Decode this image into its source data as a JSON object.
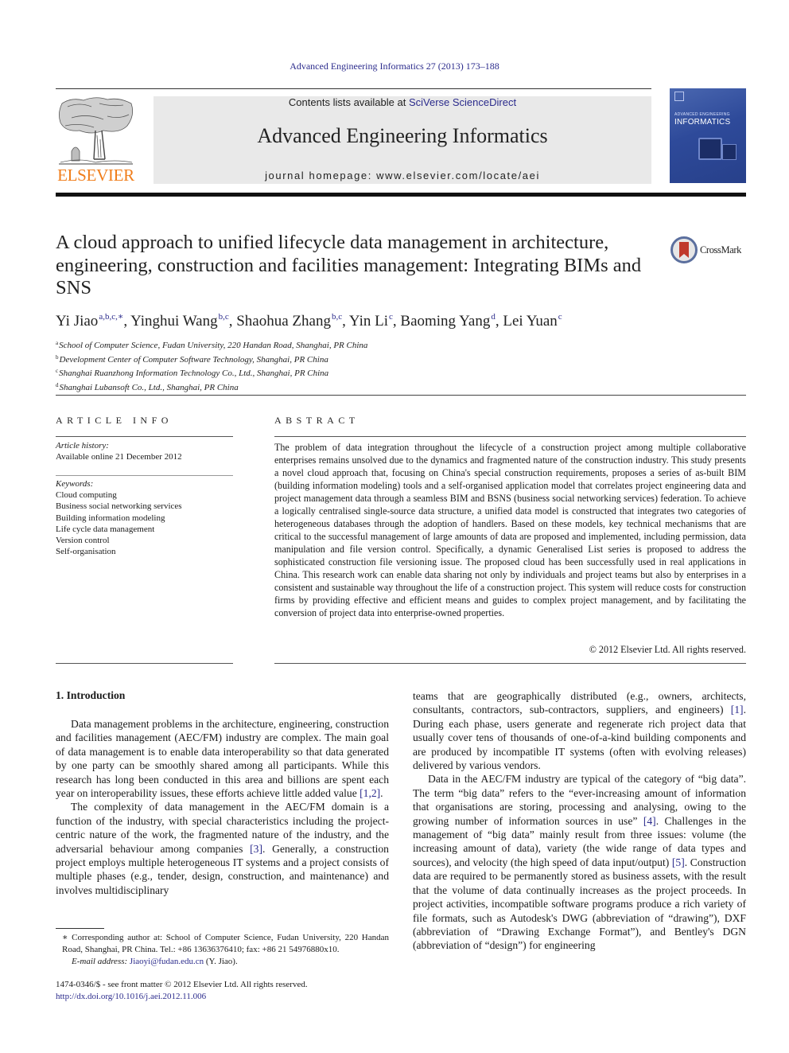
{
  "running_head": "Advanced Engineering Informatics 27 (2013) 173–188",
  "masthead": {
    "publisher_logo_text": "ELSEVIER",
    "contents_prefix": "Contents lists available at ",
    "contents_link": "SciVerse ScienceDirect",
    "journal_name": "Advanced Engineering Informatics",
    "homepage": "journal homepage: www.elsevier.com/locate/aei",
    "cover": {
      "supertitle": "ADVANCED ENGINEERING",
      "title": "INFORMATICS"
    },
    "colors": {
      "elsevier_orange": "#f07d1a",
      "link_blue": "#2b2b8c",
      "masthead_gray": "#e9e9e9",
      "cover_blue": "#2e4a9a"
    }
  },
  "article": {
    "title": "A cloud approach to unified lifecycle data management in architecture, engineering, construction and facilities management: Integrating BIMs and SNS",
    "crossmark_label": "CrossMark",
    "authors": [
      {
        "name": "Yi Jiao",
        "sup": "a,b,c,∗",
        "sep": ", "
      },
      {
        "name": "Yinghui Wang",
        "sup": "b,c",
        "sep": ", "
      },
      {
        "name": "Shaohua Zhang",
        "sup": "b,c",
        "sep": ", "
      },
      {
        "name": "Yin Li",
        "sup": "c",
        "sep": ", "
      },
      {
        "name": "Baoming Yang",
        "sup": "d",
        "sep": ", "
      },
      {
        "name": "Lei Yuan",
        "sup": "c",
        "sep": ""
      }
    ],
    "affiliations": [
      {
        "key": "a",
        "text": "School of Computer Science, Fudan University, 220 Handan Road, Shanghai, PR China"
      },
      {
        "key": "b",
        "text": "Development Center of Computer Software Technology, Shanghai, PR China"
      },
      {
        "key": "c",
        "text": "Shanghai Ruanzhong Information Technology Co., Ltd., Shanghai, PR China"
      },
      {
        "key": "d",
        "text": "Shanghai Lubansoft Co., Ltd., Shanghai, PR China"
      }
    ]
  },
  "article_info": {
    "heading": "ARTICLE INFO",
    "history_label": "Article history:",
    "history_value": "Available online 21 December 2012",
    "keywords_label": "Keywords:",
    "keywords": [
      "Cloud computing",
      "Business social networking services",
      "Building information modeling",
      "Life cycle data management",
      "Version control",
      "Self-organisation"
    ]
  },
  "abstract": {
    "heading": "ABSTRACT",
    "text": "The problem of data integration throughout the lifecycle of a construction project among multiple collaborative enterprises remains unsolved due to the dynamics and fragmented nature of the construction industry. This study presents a novel cloud approach that, focusing on China's special construction requirements, proposes a series of as-built BIM (building information modeling) tools and a self-organised application model that correlates project engineering data and project management data through a seamless BIM and BSNS (business social networking services) federation. To achieve a logically centralised single-source data structure, a unified data model is constructed that integrates two categories of heterogeneous databases through the adoption of handlers. Based on these models, key technical mechanisms that are critical to the successful management of large amounts of data are proposed and implemented, including permission, data manipulation and file version control. Specifically, a dynamic Generalised List series is proposed to address the sophisticated construction file versioning issue. The proposed cloud has been successfully used in real applications in China. This research work can enable data sharing not only by individuals and project teams but also by enterprises in a consistent and sustainable way throughout the life of a construction project. This system will reduce costs for construction firms by providing effective and efficient means and guides to complex project management, and by facilitating the conversion of project data into enterprise-owned properties.",
    "copyright": "© 2012 Elsevier Ltd. All rights reserved."
  },
  "body": {
    "section_heading": "1. Introduction",
    "left_paragraphs": [
      {
        "parts": [
          {
            "t": "Data management problems in the architecture, engineering, construction and facilities management (AEC/FM) industry are complex. The main goal of data management is to enable data interoperability so that data generated by one party can be smoothly shared among all participants. While this research has long been conducted in this area and billions are spent each year on interoperability issues, these efforts achieve little added value "
          },
          {
            "ref": "[1,2]"
          },
          {
            "t": "."
          }
        ]
      },
      {
        "parts": [
          {
            "t": "The complexity of data management in the AEC/FM domain is a function of the industry, with special characteristics including the project-centric nature of the work, the fragmented nature of the industry, and the adversarial behaviour among companies "
          },
          {
            "ref": "[3]"
          },
          {
            "t": ". Generally, a construction project employs multiple heterogeneous IT systems and a project consists of multiple phases (e.g., tender, design, construction, and maintenance) and involves multidisciplinary"
          }
        ]
      }
    ],
    "right_paragraphs": [
      {
        "noindent": true,
        "parts": [
          {
            "t": "teams that are geographically distributed (e.g., owners, architects, consultants, contractors, sub-contractors, suppliers, and engineers) "
          },
          {
            "ref": "[1]"
          },
          {
            "t": ". During each phase, users generate and regenerate rich project data that usually cover tens of thousands of one-of-a-kind building components and are produced by incompatible IT systems (often with evolving releases) delivered by various vendors."
          }
        ]
      },
      {
        "parts": [
          {
            "t": "Data in the AEC/FM industry are typical of the category of “big data”. The term “big data” refers to the “ever-increasing amount of information that organisations are storing, processing and analysing, owing to the growing number of information sources in use” "
          },
          {
            "ref": "[4]"
          },
          {
            "t": ". Challenges in the management of “big data” mainly result from three issues: volume (the increasing amount of data), variety (the wide range of data types and sources), and velocity (the high speed of data input/output) "
          },
          {
            "ref": "[5]"
          },
          {
            "t": ". Construction data are required to be permanently stored as business assets, with the result that the volume of data continually increases as the project proceeds. In project activities, incompatible software programs produce a rich variety of file formats, such as Autodesk's DWG (abbreviation of “drawing”), DXF (abbreviation of “Drawing Exchange Format”), and Bentley's DGN (abbreviation of “design”) for engineering"
          }
        ]
      }
    ]
  },
  "footnotes": {
    "corresponding": "∗ Corresponding author at: School of Computer Science, Fudan University, 220 Handan Road, Shanghai, PR China. Tel.: +86 13636376410; fax: +86 21 54976880x10.",
    "email_label": "E-mail address: ",
    "email": "Jiaoyi@fudan.edu.cn",
    "email_suffix": " (Y. Jiao).",
    "front_matter": "1474-0346/$ - see front matter © 2012 Elsevier Ltd. All rights reserved.",
    "doi": "http://dx.doi.org/10.1016/j.aei.2012.11.006"
  }
}
